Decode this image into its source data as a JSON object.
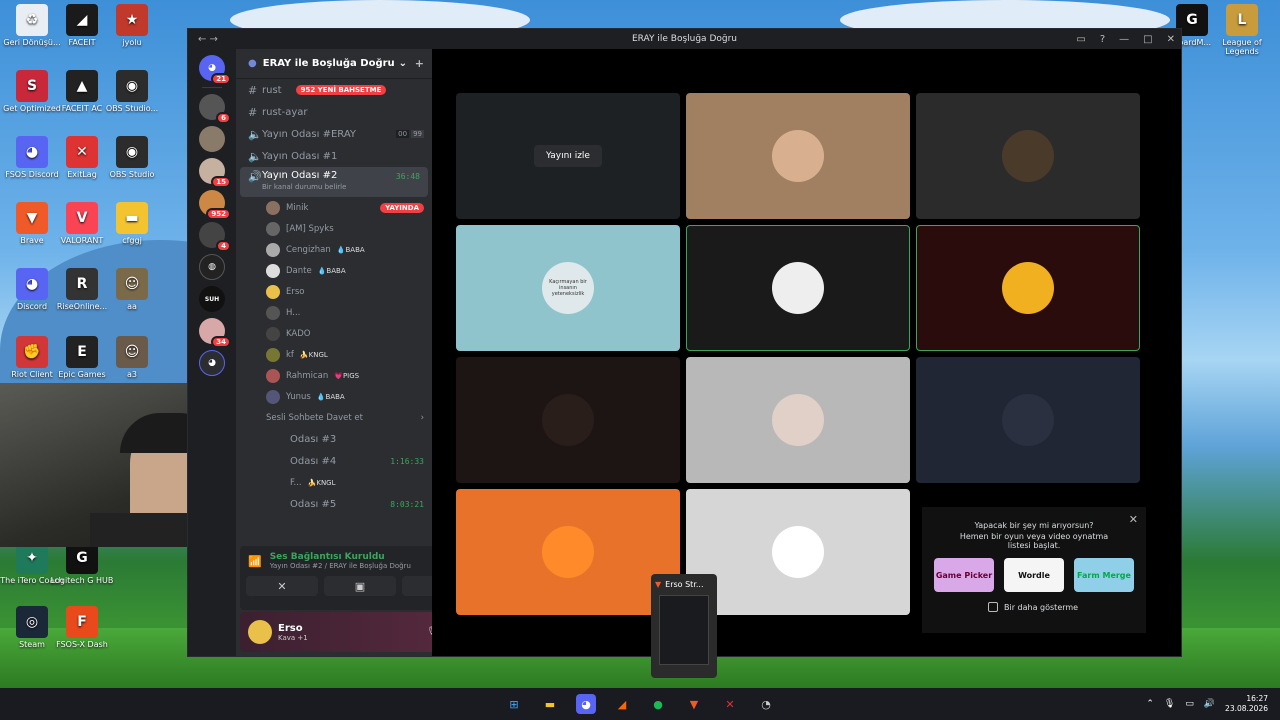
{
  "window": {
    "title": "ERAY ile Boşluğa Doğru"
  },
  "desktop": {
    "icons": [
      {
        "label": "Geri Dönüşü...",
        "color": "#e8eef4",
        "glyph": "♻"
      },
      {
        "label": "FACEIT",
        "color": "#1a1a1a",
        "glyph": "◢"
      },
      {
        "label": "jyolu",
        "color": "#c0392b",
        "glyph": "★"
      },
      {
        "label": "Get Optimized",
        "color": "#c8283a",
        "glyph": "S"
      },
      {
        "label": "FACEIT AC",
        "color": "#222",
        "glyph": "▲"
      },
      {
        "label": "OBS Studio...",
        "color": "#2c2c2c",
        "glyph": "◉"
      },
      {
        "label": "FSOS Discord",
        "color": "#5865f2",
        "glyph": "◕"
      },
      {
        "label": "ExitLag",
        "color": "#d33",
        "glyph": "✕"
      },
      {
        "label": "OBS Studio",
        "color": "#2c2c2c",
        "glyph": "◉"
      },
      {
        "label": "Brave",
        "color": "#f05a28",
        "glyph": "▼"
      },
      {
        "label": "VALORANT",
        "color": "#fa4454",
        "glyph": "V"
      },
      {
        "label": "cfggj",
        "color": "#f4c430",
        "glyph": "▬"
      },
      {
        "label": "Discord",
        "color": "#5865f2",
        "glyph": "◕"
      },
      {
        "label": "RiseOnline...",
        "color": "#333",
        "glyph": "R"
      },
      {
        "label": "aa",
        "color": "#7a6a4a",
        "glyph": "☺"
      },
      {
        "label": "Riot Client",
        "color": "#d13639",
        "glyph": "✊"
      },
      {
        "label": "Epic Games",
        "color": "#222",
        "glyph": "E"
      },
      {
        "label": "a3",
        "color": "#6a5a4a",
        "glyph": "☺"
      },
      {
        "label": "The iTero Coach",
        "color": "#1e7a5a",
        "glyph": "✦"
      },
      {
        "label": "Logitech G HUB",
        "color": "#111",
        "glyph": "G"
      },
      {
        "label": "Steam",
        "color": "#1b2838",
        "glyph": "◎"
      },
      {
        "label": "FSOS-X Dash",
        "color": "#e84a1b",
        "glyph": "F"
      },
      {
        "label": "BoardM...",
        "color": "#111",
        "glyph": "G"
      },
      {
        "label": "League of Legends",
        "color": "#c89b3c",
        "glyph": "L"
      }
    ]
  },
  "servers": {
    "badges": [
      "21",
      "6",
      "15",
      "952",
      "4",
      "34"
    ],
    "labels": [
      "SUH"
    ]
  },
  "sidebar": {
    "server_name": "ERAY ile Boşluğa Doğru",
    "channels": [
      {
        "name": "rust",
        "badge": "952 YENİ BAHSETME"
      },
      {
        "name": "rust-ayar"
      },
      {
        "name": "Yayın Odası #ERAY",
        "counts": [
          "00",
          "99"
        ]
      },
      {
        "name": "Yayın Odası #1"
      },
      {
        "name": "Yayın Odası #2",
        "time": "36:48",
        "status": "Bir kanal durumu belirle"
      }
    ],
    "users": [
      {
        "name": "Minik",
        "badge": "YAYINDA"
      },
      {
        "name": "[AM] Spyks"
      },
      {
        "name": "Cengizhan",
        "tag": "💧BABA"
      },
      {
        "name": "Dante",
        "tag": "💧BABA"
      },
      {
        "name": "Erso"
      },
      {
        "name": "H..."
      },
      {
        "name": "KADO"
      },
      {
        "name": "kf",
        "tag": "🍌KNGL"
      },
      {
        "name": "Rahmican",
        "tag": "💗PIGS"
      },
      {
        "name": "Yunus",
        "tag": "💧BABA"
      }
    ],
    "invite": "Sesli Sohbete Davet et",
    "more_channels": [
      {
        "name": "Odası #3"
      },
      {
        "name": "Odası #4",
        "time": "1:16:33"
      },
      {
        "name": "F...",
        "tag": "🍌KNGL"
      },
      {
        "name": "Odası #5",
        "time": "8:03:21"
      }
    ]
  },
  "voice_panel": {
    "status": "Ses Bağlantısı Kuruldu",
    "sub": "Yayın Odası #2 / ERAY ile Boşluğa Doğru"
  },
  "user_panel": {
    "name": "Erso",
    "activity": "Kava +1"
  },
  "stage": {
    "watch_button": "Yayını izle",
    "tiles": [
      {
        "bg": "#1e2124"
      },
      {
        "bg": "#a08060"
      },
      {
        "bg": "#2b2b2b"
      },
      {
        "bg": "#8fc4cc",
        "text": "Kaçırmayan bir insanın yeteneksizlik"
      },
      {
        "bg": "#1a1a1a"
      },
      {
        "bg": "#2a0c0c"
      },
      {
        "bg": "#1d1514"
      },
      {
        "bg": "#b8b8b8"
      },
      {
        "bg": "#202634"
      },
      {
        "bg": "#e8722a"
      },
      {
        "bg": "#d6d6d6"
      }
    ],
    "activity_card": {
      "line1": "Yapacak bir şey mi arıyorsun?",
      "line2": "Hemen bir oyun veya video oynatma listesi başlat.",
      "games": [
        "Game Picker",
        "Wordle",
        "Farm Merge"
      ],
      "checkbox": "Bir daha gösterme"
    }
  },
  "taskbar": {
    "preview_title": "Erso Str...",
    "clock": "16:27",
    "date": "23.08.2026"
  }
}
